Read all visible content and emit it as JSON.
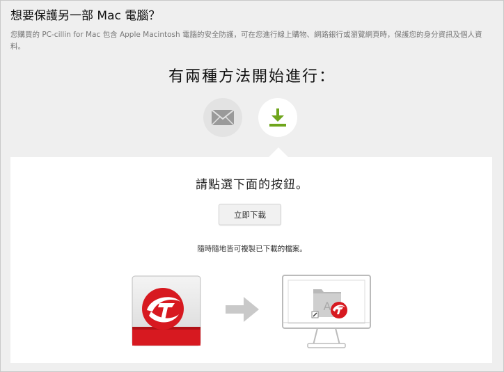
{
  "page": {
    "title": "想要保護另一部 Mac 電腦？",
    "description": "您購買的 PC-cillin for Mac 包含 Apple Macintosh 電腦的安全防護，可在您進行線上購物、網路銀行或瀏覽網頁時，保護您的身分資訊及個人資料。",
    "methods_heading": "有兩種方法開始進行：",
    "instruction": "請點選下面的按鈕。",
    "download_button": "立即下載",
    "note": "隨時隨地皆可複製已下載的檔案。"
  },
  "icons": {
    "email": "envelope-icon",
    "download": "download-icon",
    "app": "trend-micro-app-icon",
    "arrow": "right-arrow-icon",
    "mac": "imac-computer-icon"
  },
  "colors": {
    "brand_red": "#d71920",
    "download_green": "#6fa51c",
    "background": "#efefef"
  }
}
